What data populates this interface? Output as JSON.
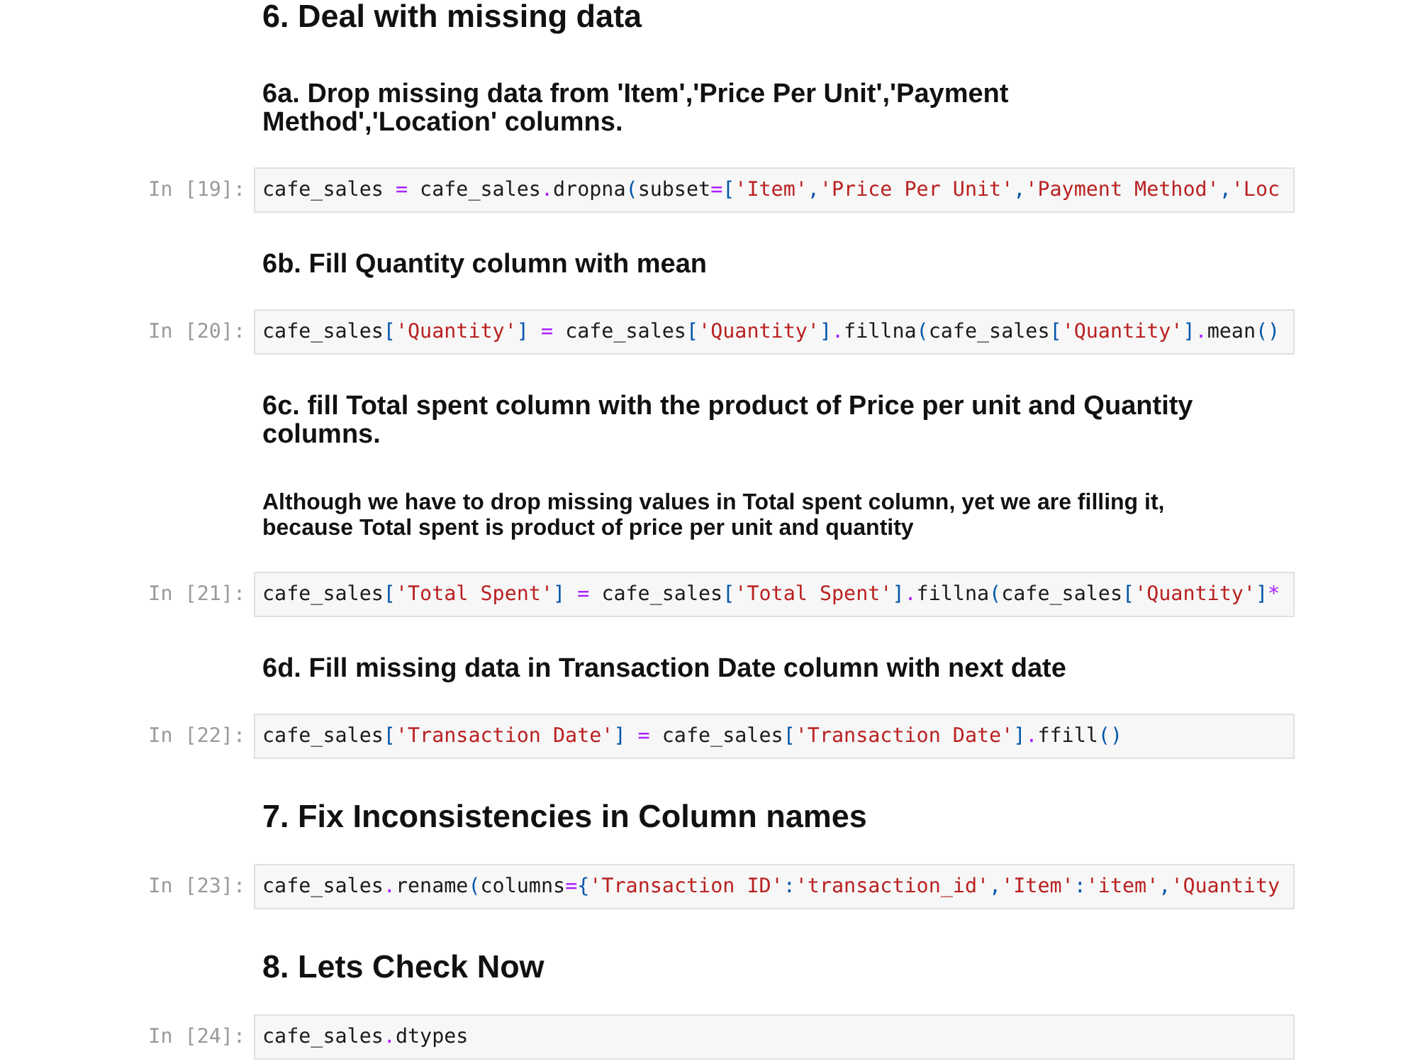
{
  "cells": [
    {
      "kind": "section",
      "text": "6. Deal with missing data"
    },
    {
      "kind": "subsection",
      "text": "6a. Drop missing data from 'Item','Price Per Unit','Payment Method','Location' columns."
    },
    {
      "kind": "code",
      "prompt": "In [19]:",
      "code": [
        {
          "kind": "name",
          "text": "cafe_sales"
        },
        {
          "kind": "operator",
          "text": " = "
        },
        {
          "kind": "name",
          "text": "cafe_sales"
        },
        {
          "kind": "operator",
          "text": "."
        },
        {
          "kind": "name",
          "text": "dropna"
        },
        {
          "kind": "punctuation",
          "text": "("
        },
        {
          "kind": "name",
          "text": "subset"
        },
        {
          "kind": "operator",
          "text": "="
        },
        {
          "kind": "punctuation",
          "text": "["
        },
        {
          "kind": "string",
          "text": "'Item'"
        },
        {
          "kind": "punctuation",
          "text": ","
        },
        {
          "kind": "string",
          "text": "'Price Per Unit'"
        },
        {
          "kind": "punctuation",
          "text": ","
        },
        {
          "kind": "string",
          "text": "'Payment Method'"
        },
        {
          "kind": "punctuation",
          "text": ","
        },
        {
          "kind": "string",
          "text": "'Loc"
        }
      ]
    },
    {
      "kind": "subsection",
      "text": "6b. Fill Quantity column with mean"
    },
    {
      "kind": "code",
      "prompt": "In [20]:",
      "code": [
        {
          "kind": "name",
          "text": "cafe_sales"
        },
        {
          "kind": "punctuation",
          "text": "["
        },
        {
          "kind": "string",
          "text": "'Quantity'"
        },
        {
          "kind": "punctuation",
          "text": "]"
        },
        {
          "kind": "operator",
          "text": " = "
        },
        {
          "kind": "name",
          "text": "cafe_sales"
        },
        {
          "kind": "punctuation",
          "text": "["
        },
        {
          "kind": "string",
          "text": "'Quantity'"
        },
        {
          "kind": "punctuation",
          "text": "]"
        },
        {
          "kind": "operator",
          "text": "."
        },
        {
          "kind": "name",
          "text": "fillna"
        },
        {
          "kind": "punctuation",
          "text": "("
        },
        {
          "kind": "name",
          "text": "cafe_sales"
        },
        {
          "kind": "punctuation",
          "text": "["
        },
        {
          "kind": "string",
          "text": "'Quantity'"
        },
        {
          "kind": "punctuation",
          "text": "]"
        },
        {
          "kind": "operator",
          "text": "."
        },
        {
          "kind": "name",
          "text": "mean"
        },
        {
          "kind": "punctuation",
          "text": "()"
        }
      ]
    },
    {
      "kind": "subsection",
      "text": "6c. fill Total spent column with the product of Price per unit and Quantity columns."
    },
    {
      "kind": "paragraph",
      "text": "Although we have to drop missing values in Total spent column, yet we are filling it, because Total spent is product of price per unit and quantity"
    },
    {
      "kind": "code",
      "prompt": "In [21]:",
      "code": [
        {
          "kind": "name",
          "text": "cafe_sales"
        },
        {
          "kind": "punctuation",
          "text": "["
        },
        {
          "kind": "string",
          "text": "'Total Spent'"
        },
        {
          "kind": "punctuation",
          "text": "]"
        },
        {
          "kind": "operator",
          "text": " = "
        },
        {
          "kind": "name",
          "text": "cafe_sales"
        },
        {
          "kind": "punctuation",
          "text": "["
        },
        {
          "kind": "string",
          "text": "'Total Spent'"
        },
        {
          "kind": "punctuation",
          "text": "]"
        },
        {
          "kind": "operator",
          "text": "."
        },
        {
          "kind": "name",
          "text": "fillna"
        },
        {
          "kind": "punctuation",
          "text": "("
        },
        {
          "kind": "name",
          "text": "cafe_sales"
        },
        {
          "kind": "punctuation",
          "text": "["
        },
        {
          "kind": "string",
          "text": "'Quantity'"
        },
        {
          "kind": "punctuation",
          "text": "]"
        },
        {
          "kind": "operator",
          "text": "*"
        }
      ]
    },
    {
      "kind": "subsection",
      "text": "6d. Fill missing data in Transaction Date column with next date"
    },
    {
      "kind": "code",
      "prompt": "In [22]:",
      "code": [
        {
          "kind": "name",
          "text": "cafe_sales"
        },
        {
          "kind": "punctuation",
          "text": "["
        },
        {
          "kind": "string",
          "text": "'Transaction Date'"
        },
        {
          "kind": "punctuation",
          "text": "]"
        },
        {
          "kind": "operator",
          "text": " = "
        },
        {
          "kind": "name",
          "text": "cafe_sales"
        },
        {
          "kind": "punctuation",
          "text": "["
        },
        {
          "kind": "string",
          "text": "'Transaction Date'"
        },
        {
          "kind": "punctuation",
          "text": "]"
        },
        {
          "kind": "operator",
          "text": "."
        },
        {
          "kind": "name",
          "text": "ffill"
        },
        {
          "kind": "punctuation",
          "text": "()"
        }
      ]
    },
    {
      "kind": "section",
      "text": "7. Fix Inconsistencies in Column names"
    },
    {
      "kind": "code",
      "prompt": "In [23]:",
      "code": [
        {
          "kind": "name",
          "text": "cafe_sales"
        },
        {
          "kind": "operator",
          "text": "."
        },
        {
          "kind": "name",
          "text": "rename"
        },
        {
          "kind": "punctuation",
          "text": "("
        },
        {
          "kind": "name",
          "text": "columns"
        },
        {
          "kind": "operator",
          "text": "="
        },
        {
          "kind": "punctuation",
          "text": "{"
        },
        {
          "kind": "string",
          "text": "'Transaction ID'"
        },
        {
          "kind": "punctuation",
          "text": ":"
        },
        {
          "kind": "string",
          "text": "'transaction_id'"
        },
        {
          "kind": "punctuation",
          "text": ","
        },
        {
          "kind": "string",
          "text": "'Item'"
        },
        {
          "kind": "punctuation",
          "text": ":"
        },
        {
          "kind": "string",
          "text": "'item'"
        },
        {
          "kind": "punctuation",
          "text": ","
        },
        {
          "kind": "string",
          "text": "'Quantity"
        }
      ]
    },
    {
      "kind": "section",
      "text": "8. Lets Check Now"
    },
    {
      "kind": "code",
      "prompt": "In [24]:",
      "code": [
        {
          "kind": "name",
          "text": "cafe_sales"
        },
        {
          "kind": "operator",
          "text": "."
        },
        {
          "kind": "name",
          "text": "dtypes"
        }
      ]
    }
  ]
}
